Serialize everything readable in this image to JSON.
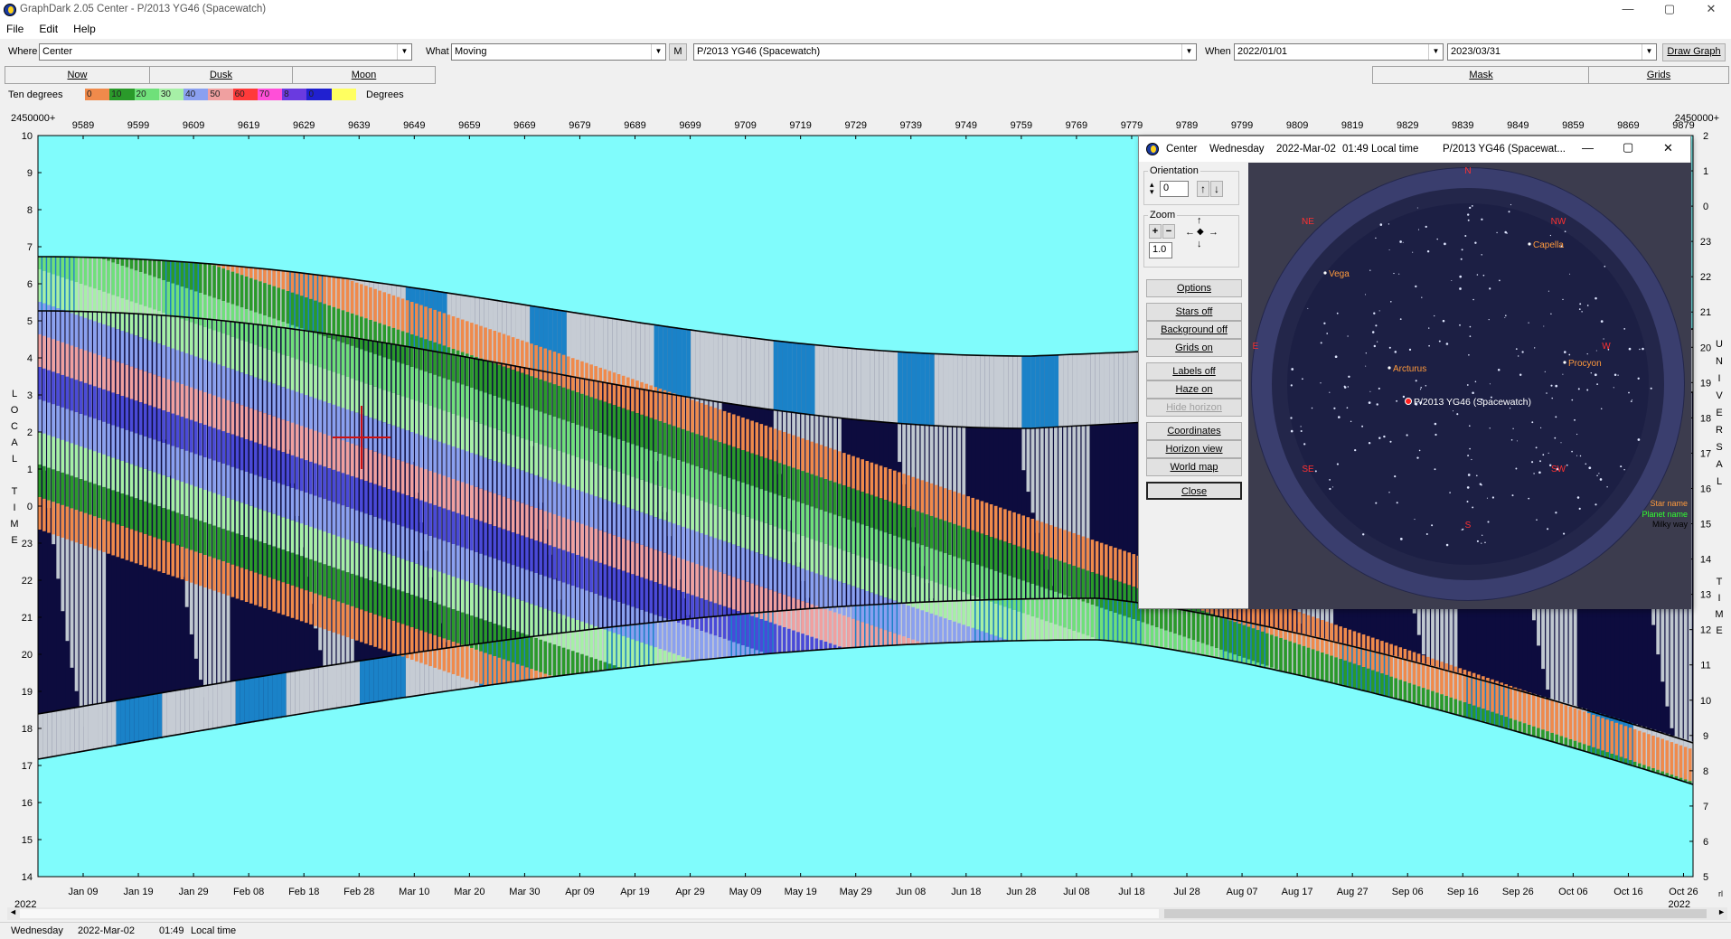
{
  "app": {
    "title": "GraphDark 2.05  Center  -  P/2013 YG46 (Spacewatch)",
    "window_controls": {
      "minimize": "—",
      "maximize": "▢",
      "close": "✕"
    }
  },
  "menu": [
    "File",
    "Edit",
    "Help"
  ],
  "toolbar": {
    "where_label": "Where",
    "where_value": "Center",
    "what_label": "What",
    "what_value": "Moving",
    "m_button": "M",
    "object_value": "P/2013 YG46 (Spacewatch)",
    "when_label": "When",
    "start_date": "2022/01/01",
    "end_date": "2023/03/31",
    "draw_button": "Draw Graph"
  },
  "tabs": {
    "now": "Now",
    "dusk": "Dusk",
    "moon": "Moon",
    "mask": "Mask",
    "grids": "Grids"
  },
  "legend": {
    "label": "Ten degrees",
    "unit": "Degrees",
    "steps": [
      {
        "v": "0",
        "c": "#f08a4b"
      },
      {
        "v": "10",
        "c": "#2a9a2a"
      },
      {
        "v": "20",
        "c": "#6fe07a"
      },
      {
        "v": "30",
        "c": "#a6f0a6"
      },
      {
        "v": "40",
        "c": "#8aa0f0"
      },
      {
        "v": "50",
        "c": "#f0a0a0"
      },
      {
        "v": "60",
        "c": "#ff3a3a"
      },
      {
        "v": "70",
        "c": "#ff4fd8"
      },
      {
        "v": "8",
        "c": "#6a3ae0"
      },
      {
        "v": "0",
        "c": "#2020d0"
      },
      {
        "v": "",
        "c": "#ffff60"
      }
    ]
  },
  "graph": {
    "jd_prefix": "2450000+",
    "jd_ticks": [
      "9589",
      "9599",
      "9609",
      "9619",
      "9629",
      "9639",
      "9649",
      "9659",
      "9669",
      "9679",
      "9689",
      "9699",
      "9709",
      "9719",
      "9729",
      "9739",
      "9749",
      "9759",
      "9769",
      "9779",
      "9789",
      "9799",
      "9809",
      "9819",
      "9829",
      "9839",
      "9849",
      "9859",
      "9869",
      "9879"
    ],
    "date_ticks": [
      "Jan 09",
      "Jan 19",
      "Jan 29",
      "Feb 08",
      "Feb 18",
      "Feb 28",
      "Mar 10",
      "Mar 20",
      "Mar 30",
      "Apr 09",
      "Apr 19",
      "Apr 29",
      "May 09",
      "May 19",
      "May 29",
      "Jun 08",
      "Jun 18",
      "Jun 28",
      "Jul 08",
      "Jul 18",
      "Jul 28",
      "Aug 07",
      "Aug 17",
      "Aug 27",
      "Sep 06",
      "Sep 16",
      "Sep 26",
      "Oct 06",
      "Oct 16",
      "Oct 26"
    ],
    "year_left": "2022",
    "year_right": "2022",
    "left_axis": [
      "10",
      "9",
      "8",
      "7",
      "6",
      "5",
      "4",
      "3",
      "2",
      "1",
      "0",
      "23",
      "22",
      "21",
      "20",
      "19",
      "18",
      "17",
      "16",
      "15",
      "14"
    ],
    "right_axis": [
      "2",
      "1",
      "0",
      "23",
      "22",
      "21",
      "20",
      "19",
      "18",
      "17",
      "16",
      "15",
      "14",
      "13",
      "12",
      "11",
      "10",
      "9",
      "8",
      "7",
      "6",
      "5"
    ],
    "left_title": [
      "L",
      "O",
      "C",
      "A",
      "L",
      "",
      "T",
      "I",
      "M",
      "E"
    ],
    "right_title_1": [
      "U",
      "N",
      "I",
      "V",
      "E",
      "R",
      "S",
      "A",
      "L"
    ],
    "right_title_2": [
      "T",
      "I",
      "M",
      "E"
    ],
    "right_corner": "rl",
    "bg_color": "#80fcfc"
  },
  "popup": {
    "icon": "moon-icon",
    "name": "Center",
    "day": "Wednesday",
    "date": "2022-Mar-02",
    "time": "01:49 Local time",
    "object": "P/2013 YG46 (Spacewat...",
    "orientation_label": "Orientation",
    "orientation_value": "0",
    "zoom_label": "Zoom",
    "zoom_value": "1.0",
    "buttons": [
      "Options",
      "Stars off",
      "Background off",
      "Grids on",
      "Labels off",
      "Haze on",
      "Hide horizon",
      "Coordinates",
      "Horizon view",
      "World map",
      "Close"
    ],
    "sky": {
      "directions": {
        "n": "N",
        "ne": "NE",
        "e": "E",
        "se": "SE",
        "s": "S",
        "sw": "SW",
        "w": "W",
        "nw": "NW"
      },
      "stars": {
        "capella": "Capella",
        "vega": "Vega",
        "arcturus": "Arcturus",
        "procyon": "Procyon"
      },
      "target": "P/2013 YG46 (Spacewatch)",
      "key": {
        "star": "Star name",
        "planet": "Planet name",
        "milky": "Milky way"
      }
    }
  },
  "status": {
    "day": "Wednesday",
    "date": "2022-Mar-02",
    "time": "01:49",
    "local": "Local time"
  }
}
